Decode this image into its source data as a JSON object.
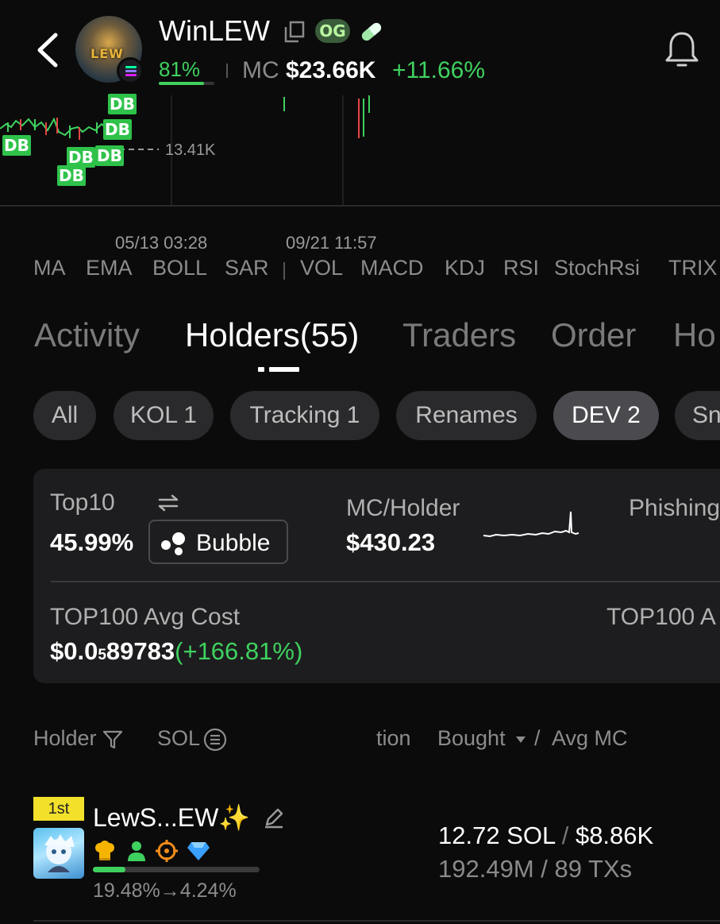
{
  "header": {
    "token_name": "WinLEW",
    "og_badge": "OG",
    "progress_pct": "81%",
    "progress_fraction": 0.81,
    "mc_label": "MC",
    "mc_value": "$23.66K",
    "mc_change": "+11.66%",
    "icons": [
      "back-arrow-icon",
      "copy-icon",
      "pill-icon",
      "bell-icon",
      "solana-icon"
    ],
    "avatar_text": "LEW"
  },
  "chart": {
    "markers": [
      "DB",
      "DB",
      "DB",
      "DB",
      "DB",
      "DB"
    ],
    "price_line_label": "13.41K",
    "time_labels": [
      "05/13 03:28",
      "09/21 11:57"
    ]
  },
  "indicators": {
    "main": [
      "MA",
      "EMA",
      "BOLL",
      "SAR"
    ],
    "sub": [
      "VOL",
      "MACD",
      "KDJ",
      "RSI",
      "StochRsi",
      "TRIX"
    ]
  },
  "tabs": [
    "Activity",
    "Holders(55)",
    "Traders",
    "Order",
    "Ho"
  ],
  "active_tab": "Holders(55)",
  "chips": [
    "All",
    "KOL 1",
    "Tracking 1",
    "Renames",
    "DEV 2",
    "Sn"
  ],
  "active_chip": "DEV 2",
  "stats": {
    "top10_label": "Top10",
    "top10_value": "45.99%",
    "bubble_label": "Bubble",
    "mc_holder_label": "MC/Holder",
    "mc_holder_value": "$430.23",
    "phishing_label": "Phishing",
    "top100_cost_label": "TOP100 Avg Cost",
    "top100_cost_prefix": "$0.0",
    "top100_cost_sub": "5",
    "top100_cost_rest": "89783",
    "top100_cost_change": "(+166.81%)",
    "top100_right_label": "TOP100 A"
  },
  "table_header": {
    "holder": "Holder",
    "sol": "SOL",
    "position": "tion",
    "bought": "Bought",
    "slash": "/",
    "avg_mc": "Avg MC"
  },
  "rows": [
    {
      "rank": "1st",
      "name": "LewS...EW✨",
      "bought_sol": "12.72 SOL",
      "slash": "/",
      "bought_usd": "$8.86K",
      "sub": "192.49M / 89 TXs",
      "holding_change": "19.48%→4.24%",
      "holding_fraction": 0.1948,
      "tag_icons": [
        "chef-hat-icon",
        "person-icon",
        "target-icon",
        "diamond-icon"
      ]
    }
  ],
  "colors": {
    "positive": "#3fd15f",
    "background": "#0b0b0b",
    "card": "#1d1d1f",
    "og_badge": "#3a5c3a",
    "rank_badge": "#f2e02b"
  }
}
